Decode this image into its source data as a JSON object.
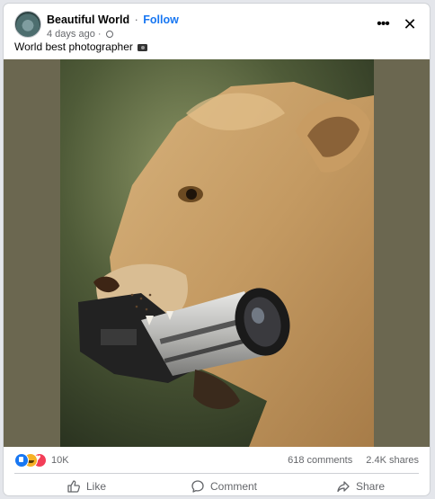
{
  "post": {
    "page_name": "Beautiful World",
    "separator": "·",
    "follow_label": "Follow",
    "timestamp": "4 days ago ·",
    "caption": "World best photographer"
  },
  "header_actions": {
    "more_icon": "more-horizontal-icon",
    "close_icon": "close-icon",
    "more_glyph": "•••",
    "close_glyph": "✕"
  },
  "photo": {
    "subject": "lioness-holding-camera",
    "background_color": "#6b6750"
  },
  "engagement": {
    "reaction_types": [
      "like",
      "haha",
      "love"
    ],
    "reaction_count": "10K",
    "comments": "618 comments",
    "shares": "2.4K shares"
  },
  "actions": {
    "like_label": "Like",
    "comment_label": "Comment",
    "share_label": "Share"
  },
  "colors": {
    "accent": "#1877f2",
    "muted_text": "#65676b",
    "like": "#1877f2",
    "haha": "#f7b125",
    "love": "#f33e58"
  }
}
